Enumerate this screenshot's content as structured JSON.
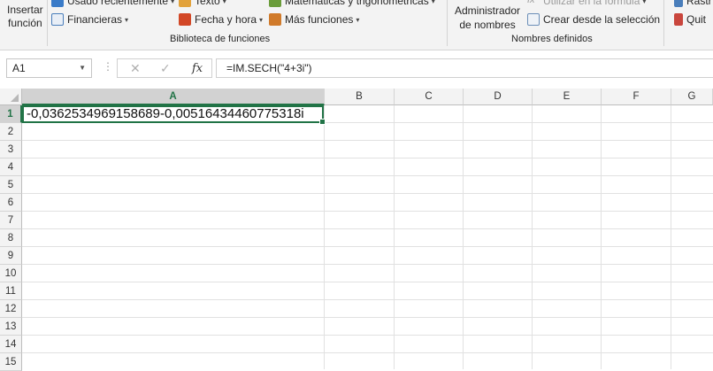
{
  "ribbon": {
    "insert_function_line1": "Insertar",
    "insert_function_line2": "función",
    "recently_used": "Usado recientemente",
    "text": "Texto",
    "math_trig": "Matemáticas y trigonométricas",
    "financial": "Financieras",
    "date_time": "Fecha y hora",
    "more_functions": "Más funciones",
    "function_library_label": "Biblioteca de funciones",
    "name_manager_line1": "Administrador",
    "name_manager_line2": "de nombres",
    "use_in_formula": "Utilizar en la fórmula",
    "create_from_selection": "Crear desde la selección",
    "defined_names_label": "Nombres definidos",
    "trace_label": "Rastr",
    "quitar_label": "Quit"
  },
  "formula_bar": {
    "name_box": "A1",
    "formula": "=IM.SECH(\"4+3i\")",
    "fx": "fx"
  },
  "sheet": {
    "columns": [
      "A",
      "B",
      "C",
      "D",
      "E",
      "F",
      "G"
    ],
    "rows": [
      "1",
      "2",
      "3",
      "4",
      "5",
      "6",
      "7",
      "8",
      "9",
      "10",
      "11",
      "12",
      "13",
      "14",
      "15"
    ],
    "active_cell_value": "-0,0362534969158689-0,00516434460775318i"
  },
  "colors": {
    "accent": "#217346",
    "ribbon_bg": "#f3f3f3"
  }
}
